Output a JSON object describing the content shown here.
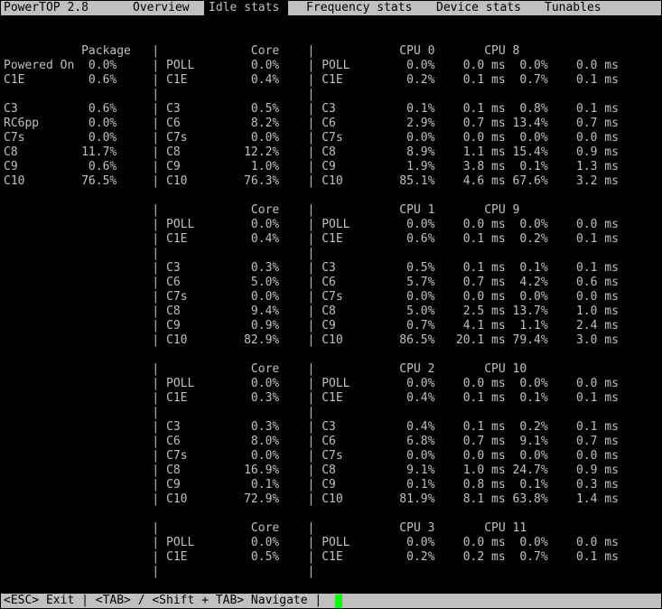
{
  "app": {
    "name": "PowerTOP 2.8"
  },
  "tabs": [
    {
      "label": "Overview",
      "active": false
    },
    {
      "label": "Idle stats",
      "active": true
    },
    {
      "label": "Frequency stats",
      "active": false
    },
    {
      "label": "Device stats",
      "active": false
    },
    {
      "label": "Tunables",
      "active": false
    }
  ],
  "screen_lines": [
    "",
    "           Package   |             Core    |            CPU 0       CPU 8",
    "Powered On  0.0%     | POLL        0.0%    | POLL        0.0%    0.0 ms  0.0%    0.0 ms",
    "C1E         0.6%     | C1E         0.4%    | C1E         0.2%    0.1 ms  0.7%    0.1 ms",
    "                     |                     |",
    "C3          0.6%     | C3          0.5%    | C3          0.1%    0.1 ms  0.8%    0.1 ms",
    "RC6pp       0.0%     | C6          8.2%    | C6          2.9%    0.7 ms 13.4%    0.7 ms",
    "C7s         0.0%     | C7s         0.0%    | C7s         0.0%    0.0 ms  0.0%    0.0 ms",
    "C8         11.7%     | C8         12.2%    | C8          8.9%    1.1 ms 15.4%    0.9 ms",
    "C9          0.6%     | C9          1.0%    | C9          1.9%    3.8 ms  0.1%    1.3 ms",
    "C10        76.5%     | C10        76.3%    | C10        85.1%    4.6 ms 67.6%    3.2 ms",
    "",
    "                     |             Core    |            CPU 1       CPU 9",
    "                     | POLL        0.0%    | POLL        0.0%    0.0 ms  0.0%    0.0 ms",
    "                     | C1E         0.4%    | C1E         0.6%    0.1 ms  0.2%    0.1 ms",
    "                     |                     |",
    "                     | C3          0.3%    | C3          0.5%    0.1 ms  0.1%    0.1 ms",
    "                     | C6          5.0%    | C6          5.7%    0.7 ms  4.2%    0.6 ms",
    "                     | C7s         0.0%    | C7s         0.0%    0.0 ms  0.0%    0.0 ms",
    "                     | C8          9.4%    | C8          5.0%    2.5 ms 13.7%    1.0 ms",
    "                     | C9          0.9%    | C9          0.7%    4.1 ms  1.1%    2.4 ms",
    "                     | C10        82.9%    | C10        86.5%   20.1 ms 79.4%    3.0 ms",
    "",
    "                     |             Core    |            CPU 2       CPU 10",
    "                     | POLL        0.0%    | POLL        0.0%    0.0 ms  0.0%    0.0 ms",
    "                     | C1E         0.3%    | C1E         0.4%    0.1 ms  0.1%    0.1 ms",
    "                     |                     |",
    "                     | C3          0.3%    | C3          0.4%    0.1 ms  0.2%    0.1 ms",
    "                     | C6          8.0%    | C6          6.8%    0.7 ms  9.1%    0.7 ms",
    "                     | C7s         0.0%    | C7s         0.0%    0.0 ms  0.0%    0.0 ms",
    "                     | C8         16.9%    | C8          9.1%    1.0 ms 24.7%    0.9 ms",
    "                     | C9          0.1%    | C9          0.1%    0.8 ms  0.1%    0.3 ms",
    "                     | C10        72.9%    | C10        81.9%    8.1 ms 63.8%    1.4 ms",
    "",
    "                     |             Core    |            CPU 3       CPU 11",
    "                     | POLL        0.0%    | POLL        0.0%    0.0 ms  0.0%    0.0 ms",
    "                     | C1E         0.5%    | C1E         0.2%    0.2 ms  0.7%    0.1 ms",
    "                     |                     |"
  ],
  "status_bar": {
    "hint": "<ESC> Exit | <TAB> / <Shift + TAB> Navigate |"
  },
  "colors": {
    "background": "#000000",
    "text": "#c0c0c0",
    "bar": "#c0c0c0",
    "cursor": "#00ff00"
  }
}
